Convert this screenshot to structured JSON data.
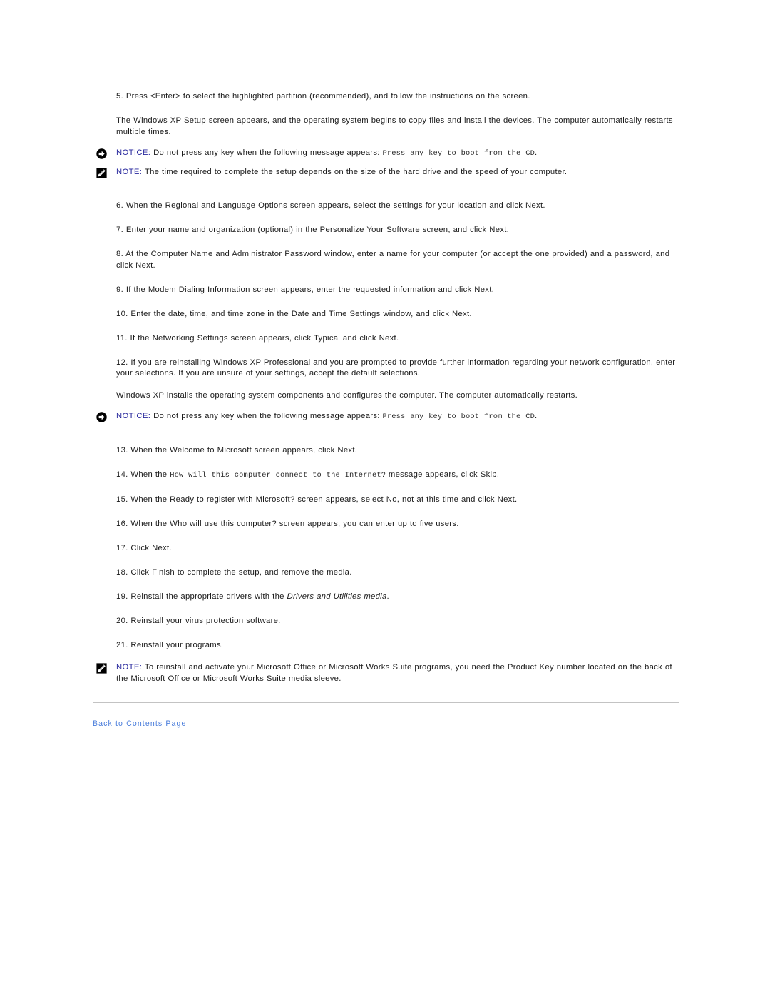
{
  "document": {
    "type": "procedure-continuation",
    "accent_link_color": "#4a7ddb",
    "callout_label_color": "#26269c",
    "rule_color": "#c3c3c3"
  },
  "steps": [
    {
      "number": "5.",
      "text": "Press <Enter> to select the highlighted partition (recommended), and follow the instructions on the screen."
    },
    {
      "number": "6.",
      "text": "When the Regional and Language Options screen appears, select the settings for your location and click Next."
    },
    {
      "number": "7.",
      "text": "Enter your name and organization (optional) in the Personalize Your Software screen, and click Next."
    },
    {
      "number": "8.",
      "text": "At the Computer Name and Administrator Password window, enter a name for your computer (or accept the one provided) and a password, and click Next."
    },
    {
      "number": "9.",
      "text": "If the Modem Dialing Information screen appears, enter the requested information and click Next."
    },
    {
      "number": "10.",
      "text": "Enter the date, time, and time zone in the Date and Time Settings window, and click Next."
    },
    {
      "number": "11.",
      "text": "If the Networking Settings screen appears, click Typical and click Next."
    },
    {
      "number": "12.",
      "text": "If you are reinstalling Windows XP Professional and you are prompted to provide further information regarding your network configuration, enter your selections. If you are unsure of your settings, accept the default selections."
    },
    {
      "number": "13.",
      "text": "When the Welcome to Microsoft screen appears, click Next."
    },
    {
      "number": "14.",
      "prefix": "When the ",
      "code": "How will this computer connect to the Internet?",
      "suffix": " message appears, click Skip."
    },
    {
      "number": "15.",
      "text": "When the Ready to register with Microsoft? screen appears, select No, not at this time and click Next."
    },
    {
      "number": "16.",
      "text": "When the Who will use this computer? screen appears, you can enter up to five users."
    },
    {
      "number": "17.",
      "text": "Click Next."
    },
    {
      "number": "18.",
      "text": "Click Finish to complete the setup, and remove the media."
    },
    {
      "number": "19.",
      "prefix": "Reinstall the appropriate drivers with the ",
      "italic": "Drivers and Utilities media",
      "suffix": "."
    },
    {
      "number": "20.",
      "text": "Reinstall your virus protection software."
    },
    {
      "number": "21.",
      "text": "Reinstall your programs."
    }
  ],
  "paragraphs": {
    "setup_screen": "The Windows XP Setup screen appears, and the operating system begins to copy files and install the devices. The computer automatically restarts multiple times.",
    "installs_components": "Windows XP installs the operating system components and configures the computer. The computer automatically restarts."
  },
  "callouts": {
    "notice_1": {
      "icon": "notice-arrow-icon",
      "label": "NOTICE:",
      "text": " Do not press any key when the following message appears: ",
      "code": "Press any key to boot from the CD",
      "trailing": "."
    },
    "note_1": {
      "icon": "note-pencil-icon",
      "label": "NOTE:",
      "text": " The time required to complete the setup depends on the size of the hard drive and the speed of your computer."
    },
    "notice_2": {
      "icon": "notice-arrow-icon",
      "label": "NOTICE:",
      "text": " Do not press any key when the following message appears: ",
      "code": "Press any key to boot from the CD",
      "trailing": "."
    },
    "note_2": {
      "icon": "note-pencil-icon",
      "label": "NOTE:",
      "text": " To reinstall and activate your Microsoft Office or Microsoft Works Suite programs, you need the Product Key number located on the back of the Microsoft Office or Microsoft Works Suite media sleeve."
    }
  },
  "footer": {
    "back_link": "Back to Contents Page"
  }
}
